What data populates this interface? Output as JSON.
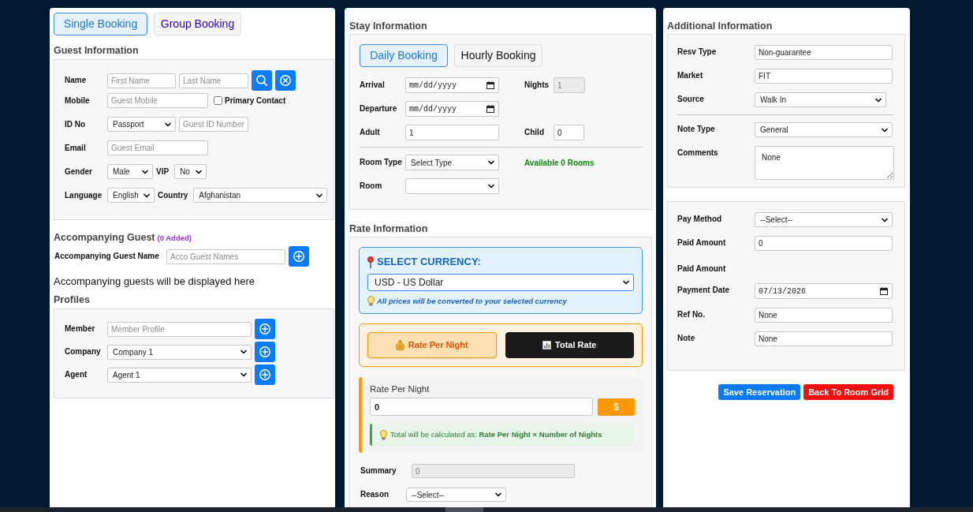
{
  "booking_tabs": [
    {
      "label": "Single Booking",
      "selected": true
    },
    {
      "label": "Group Booking",
      "selected": false
    }
  ],
  "guest_information": {
    "title": "Guest Information",
    "rows": [
      {
        "label": "Name",
        "controls": [
          {
            "kind": "input",
            "placeholder": "First Name"
          },
          {
            "kind": "input",
            "placeholder": "Last Name"
          },
          {
            "kind": "search"
          },
          {
            "kind": "clear"
          }
        ]
      },
      {
        "label": "Mobile",
        "controls": [
          {
            "kind": "input",
            "placeholder": "Guest Mobile"
          },
          {
            "kind": "checkbox",
            "label": "Primary Contact",
            "checked": false
          }
        ]
      },
      {
        "label": "ID No",
        "controls": [
          {
            "kind": "select",
            "value": "Passport"
          },
          {
            "kind": "input",
            "placeholder": "Guest ID Number"
          }
        ]
      },
      {
        "label": "Email",
        "controls": [
          {
            "kind": "input",
            "placeholder": "Guest Email"
          }
        ]
      },
      {
        "label": "Gender",
        "controls": [
          {
            "kind": "select",
            "value": "Male"
          },
          {
            "kind": "label",
            "text": "VIP"
          },
          {
            "kind": "select",
            "value": "No"
          }
        ]
      },
      {
        "label": "Language",
        "controls": [
          {
            "kind": "select",
            "value": "English"
          },
          {
            "kind": "label",
            "text": "Country"
          },
          {
            "kind": "select",
            "value": "Afghanistan"
          }
        ]
      }
    ]
  },
  "accompanying_guest": {
    "title": "Accompanying Guest",
    "count": "(0 Added)",
    "name_label": "Accompanying Guest Name",
    "placeholder": "Acco Guest Names",
    "empty_message": "Accompanying guests will be displayed here"
  },
  "profiles": {
    "title": "Profiles",
    "rows": [
      {
        "label": "Member",
        "kind": "input",
        "placeholder": "Member Profile"
      },
      {
        "label": "Company",
        "kind": "select",
        "value": "Company 1"
      },
      {
        "label": "Agent",
        "kind": "select",
        "value": "Agent 1"
      }
    ]
  },
  "stay_information": {
    "title": "Stay Information",
    "booking_types": [
      {
        "label": "Daily Booking",
        "selected": true
      },
      {
        "label": "Hourly Booking",
        "selected": false
      }
    ],
    "rows": [
      {
        "fields": [
          {
            "label": "Arrival",
            "kind": "date",
            "placeholder": "mm/dd/yyyy",
            "disabled": false
          },
          {
            "label": "Nights",
            "kind": "input",
            "value": "1",
            "disabled": true
          }
        ]
      },
      {
        "fields": [
          {
            "label": "Departure",
            "kind": "date",
            "placeholder": "mm/dd/yyyy",
            "disabled": false
          }
        ]
      },
      {
        "fields": [
          {
            "label": "Adult",
            "kind": "input",
            "value": "1",
            "disabled": false
          },
          {
            "label": "Child",
            "kind": "input",
            "value": "0",
            "disabled": false
          }
        ]
      }
    ],
    "room_rows": [
      {
        "label": "Room Type",
        "kind": "select",
        "value": "Select Type"
      },
      {
        "label": "Room",
        "kind": "select"
      }
    ],
    "availability": "Available 0 Rooms"
  },
  "rate_information": {
    "title": "Rate Information",
    "currency": {
      "title": "SELECT CURRENCY:",
      "value": "USD - US Dollar",
      "hint": "All prices will be converted to your selected currency"
    },
    "rate_modes": [
      {
        "label": "Rate Per Night",
        "kind": "nightly",
        "selected": true
      },
      {
        "label": "Total Rate",
        "kind": "total",
        "selected": false
      }
    ],
    "rate_input": {
      "label": "Rate Per Night",
      "value": "0",
      "currency_symbol": "$",
      "formula": "Total will be calculated as: **Rate Per Night × Number of Nights**"
    },
    "rows": [
      {
        "label": "Summary",
        "kind": "input",
        "value": "0",
        "disabled": true
      },
      {
        "label": "Reason",
        "kind": "select",
        "value": "--Select--",
        "disabled": false
      }
    ]
  },
  "additional_information": {
    "title": "Additional Information",
    "rows": [
      {
        "label": "Resv Type",
        "kind": "input",
        "value": "Non-guarantee"
      },
      {
        "label": "Market",
        "kind": "input",
        "value": "FIT"
      },
      {
        "label": "Source",
        "kind": "select",
        "value": "Walk In"
      }
    ],
    "note_rows": [
      {
        "label": "Note Type",
        "kind": "select",
        "value": "General"
      },
      {
        "label": "Comments",
        "kind": "textarea",
        "value": "None"
      }
    ]
  },
  "payment": {
    "rows": [
      {
        "label": "Pay Method",
        "kind": "select",
        "value": "--Select--"
      },
      {
        "label": "Paid Amount",
        "kind": "input",
        "value": "0"
      },
      {
        "label": "Paid Amount",
        "kind": "bare"
      },
      {
        "label": "Payment Date",
        "kind": "date",
        "value": "07/13/2026"
      },
      {
        "label": "Ref No.",
        "kind": "input",
        "value": "None"
      },
      {
        "label": "Note",
        "kind": "input",
        "value": "None"
      }
    ]
  },
  "actions": [
    {
      "label": "Save Reservation",
      "kind": "primary"
    },
    {
      "label": "Back To Room Grid",
      "kind": "danger"
    }
  ]
}
